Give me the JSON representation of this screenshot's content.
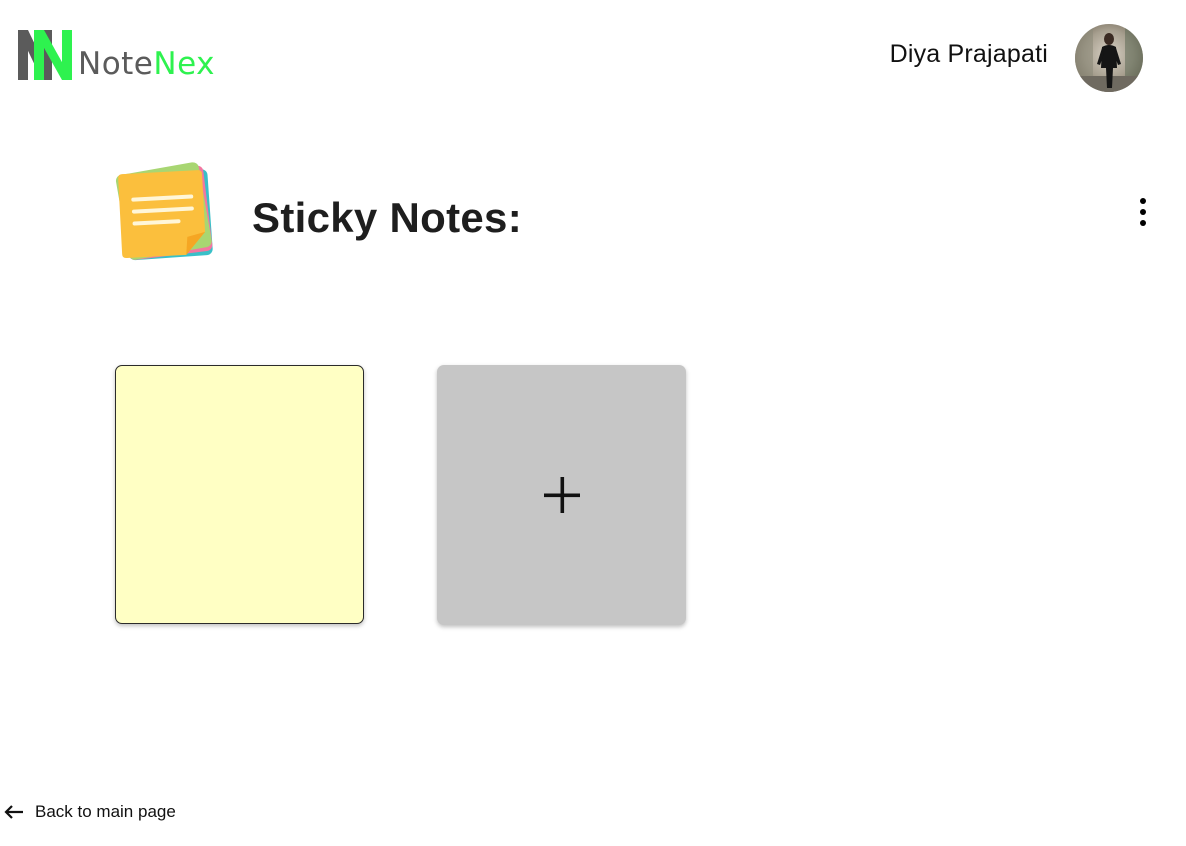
{
  "header": {
    "logo": {
      "text_part1": "Note",
      "text_part2": "Nex",
      "mark_letters": "NN",
      "colors": {
        "gray": "#5b5b5b",
        "green": "#2ef24f"
      }
    },
    "user": {
      "name": "Diya Prajapati",
      "avatar_icon": "user-photo-avatar"
    }
  },
  "main": {
    "title": "Sticky Notes:",
    "title_icon": "sticky-notes-icon",
    "menu_icon": "more-vertical-icon",
    "notes": [
      {
        "color": "#ffffc4",
        "text": ""
      }
    ],
    "add_button_icon": "plus-icon",
    "add_card_color": "#c6c6c6"
  },
  "footer": {
    "back_label": "Back to main page",
    "back_icon": "arrow-left-icon"
  }
}
